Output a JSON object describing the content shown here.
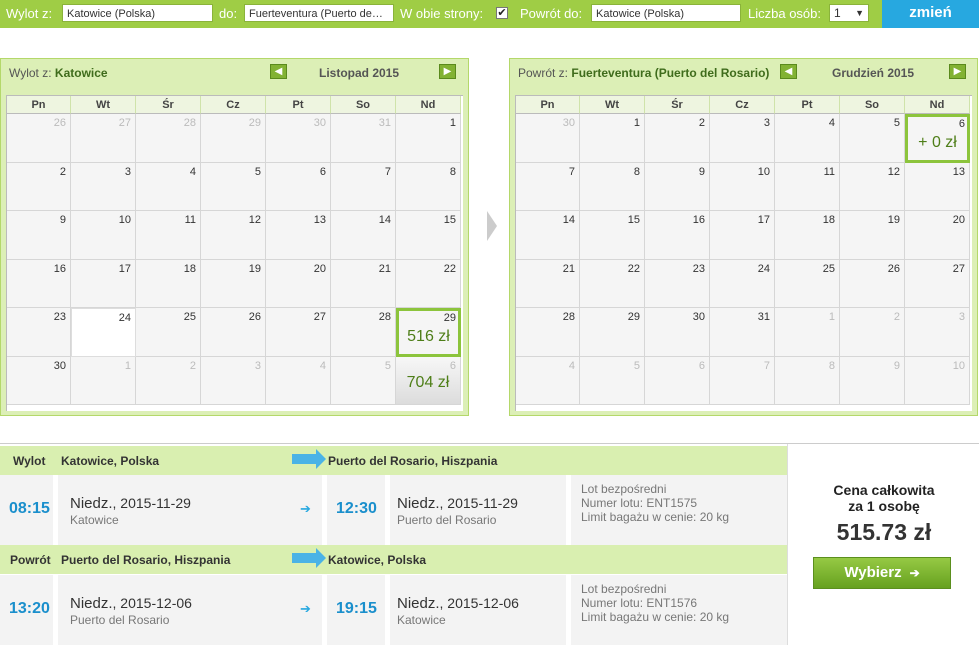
{
  "search": {
    "from_label": "Wylot z:",
    "from_value": "Katowice (Polska)",
    "to_label": "do:",
    "to_value": "Fuerteventura (Puerto de…",
    "roundtrip_label": "W obie strony:",
    "roundtrip_checked": "✔",
    "return_label": "Powrót do:",
    "return_value": "Katowice (Polska)",
    "persons_label": "Liczba osób:",
    "persons_value": "1",
    "submit_label": "zmień"
  },
  "outbound_calendar": {
    "title_prefix": "Wylot z:",
    "title_city": "Katowice",
    "month": "Listopad 2015",
    "weekdays": [
      "Pn",
      "Wt",
      "Śr",
      "Cz",
      "Pt",
      "So",
      "Nd"
    ],
    "weeks": [
      [
        "26",
        "27",
        "28",
        "29",
        "30",
        "31",
        "1"
      ],
      [
        "2",
        "3",
        "4",
        "5",
        "6",
        "7",
        "8"
      ],
      [
        "9",
        "10",
        "11",
        "12",
        "13",
        "14",
        "15"
      ],
      [
        "16",
        "17",
        "18",
        "19",
        "20",
        "21",
        "22"
      ],
      [
        "23",
        "24",
        "25",
        "26",
        "27",
        "28",
        "29"
      ],
      [
        "30",
        "1",
        "2",
        "3",
        "4",
        "5",
        "6"
      ]
    ],
    "price_29": "516 zł",
    "price_6": "704 zł"
  },
  "return_calendar": {
    "title_prefix": "Powrót z:",
    "title_city": "Fuerteventura (Puerto del Rosario)",
    "month": "Grudzień 2015",
    "weekdays": [
      "Pn",
      "Wt",
      "Śr",
      "Cz",
      "Pt",
      "So",
      "Nd"
    ],
    "weeks": [
      [
        "30",
        "1",
        "2",
        "3",
        "4",
        "5",
        "6"
      ],
      [
        "7",
        "8",
        "9",
        "10",
        "11",
        "12",
        "13"
      ],
      [
        "14",
        "15",
        "16",
        "17",
        "18",
        "19",
        "20"
      ],
      [
        "21",
        "22",
        "23",
        "24",
        "25",
        "26",
        "27"
      ],
      [
        "28",
        "29",
        "30",
        "31",
        "1",
        "2",
        "3"
      ],
      [
        "4",
        "5",
        "6",
        "7",
        "8",
        "9",
        "10"
      ]
    ],
    "price_6": "+ 0 zł"
  },
  "outbound_flight": {
    "label": "Wylot",
    "from": "Katowice, Polska",
    "to": "Puerto del Rosario, Hiszpania",
    "dep_time": "08:15",
    "dep_day": "Niedz.",
    "dep_date": ", 2015-11-29",
    "dep_place": "Katowice",
    "arr_time": "12:30",
    "arr_day": "Niedz.",
    "arr_date": ", 2015-11-29",
    "arr_place": "Puerto del Rosario",
    "info1": "Lot bezpośredni",
    "info2": "Numer lotu: ENT1575",
    "info3": "Limit bagażu w cenie: 20 kg"
  },
  "return_flight": {
    "label": "Powrót",
    "from": "Puerto del Rosario, Hiszpania",
    "to": "Katowice, Polska",
    "dep_time": "13:20",
    "dep_day": "Niedz.",
    "dep_date": ", 2015-12-06",
    "dep_place": "Puerto del Rosario",
    "arr_time": "19:15",
    "arr_day": "Niedz.",
    "arr_date": ", 2015-12-06",
    "arr_place": "Katowice",
    "info1": "Lot bezpośredni",
    "info2": "Numer lotu: ENT1576",
    "info3": "Limit bagażu w cenie: 20 kg"
  },
  "price": {
    "label_line1": "Cena całkowita",
    "label_line2": "za 1 osobę",
    "amount": "515.73 zł",
    "button": "Wybierz"
  }
}
